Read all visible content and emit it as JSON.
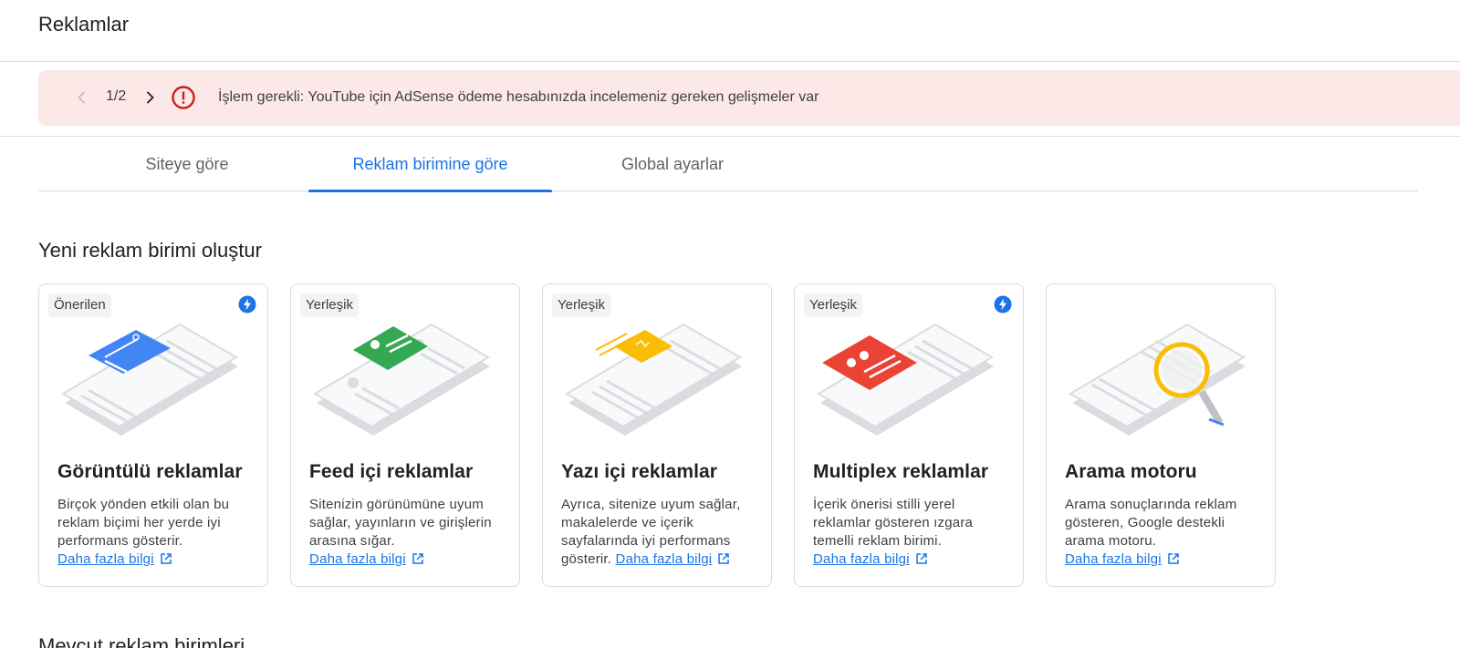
{
  "page": {
    "title": "Reklamlar"
  },
  "alert": {
    "pager": "1/2",
    "message": "İşlem gerekli: YouTube için AdSense ödeme hesabınızda incelemeniz gereken gelişmeler var",
    "prev_icon": "chevron-left-icon",
    "next_icon": "chevron-right-icon",
    "status_icon": "error-icon",
    "background": "#fce8e6",
    "icon_color": "#c5221f"
  },
  "tabs": [
    {
      "label": "Siteye göre",
      "active": false
    },
    {
      "label": "Reklam birimine göre",
      "active": true
    },
    {
      "label": "Global ayarlar",
      "active": false
    }
  ],
  "section_new": {
    "title": "Yeni reklam birimi oluştur"
  },
  "cards": [
    {
      "chip": "Önerilen",
      "bolt": true,
      "title": "Görüntülü reklamlar",
      "desc": "Birçok yönden etkili olan bu reklam biçimi her yerde iyi performans gösterir.",
      "link": "Daha fazla bilgi",
      "accent": "#4285f4"
    },
    {
      "chip": "Yerleşik",
      "bolt": false,
      "title": "Feed içi reklamlar",
      "desc": "Sitenizin görünümüne uyum sağlar, yayınların ve girişlerin arasına sığar.",
      "link": "Daha fazla bilgi",
      "accent": "#34a853"
    },
    {
      "chip": "Yerleşik",
      "bolt": false,
      "title": "Yazı içi reklamlar",
      "desc": "Ayrıca, sitenize uyum sağlar, makalelerde ve içerik sayfalarında iyi performans gösterir.",
      "link": "Daha fazla bilgi",
      "accent": "#fbbc04"
    },
    {
      "chip": "Yerleşik",
      "bolt": true,
      "title": "Multiplex reklamlar",
      "desc": "İçerik önerisi stilli yerel reklamlar gösteren ızgara temelli reklam birimi.",
      "link": "Daha fazla bilgi",
      "accent": "#ea4335"
    },
    {
      "chip": "",
      "bolt": false,
      "title": "Arama motoru",
      "desc": "Arama sonuçlarında reklam gösteren, Google destekli arama motoru.",
      "link": "Daha fazla bilgi",
      "accent": "#fbbc04"
    }
  ],
  "section_existing": {
    "title": "Mevcut reklam birimleri"
  },
  "colors": {
    "primary": "#1a73e8",
    "border": "#dadce0",
    "bolt": "#1a73e8"
  }
}
